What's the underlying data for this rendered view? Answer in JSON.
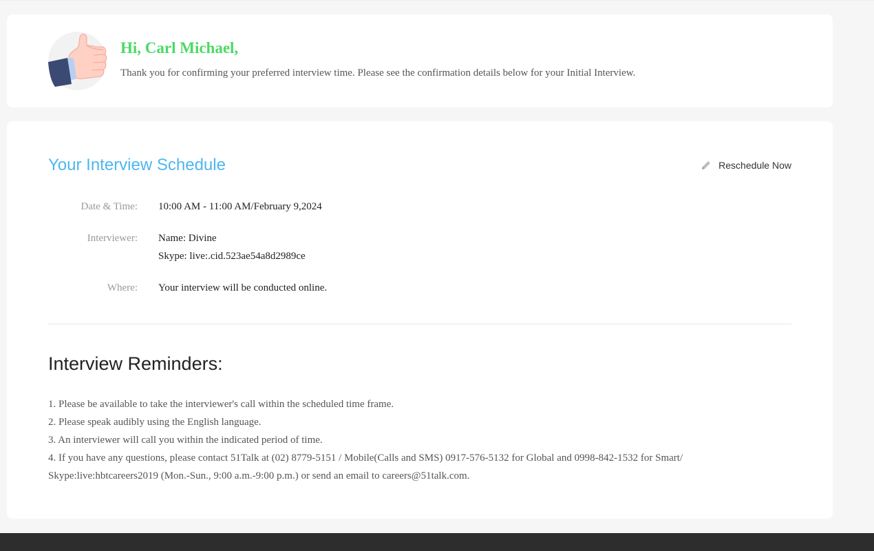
{
  "greeting": {
    "title": "Hi, Carl Michael,",
    "message": "Thank you for confirming your preferred interview time. Please see the confirmation details below for your Initial Interview."
  },
  "schedule": {
    "title": "Your Interview Schedule",
    "reschedule_label": "Reschedule Now",
    "rows": {
      "datetime": {
        "label": "Date & Time:",
        "value": "10:00 AM - 11:00 AM/February 9,2024"
      },
      "interviewer": {
        "label": "Interviewer:",
        "name": "Name: Divine",
        "skype": "Skype: live:.cid.523ae54a8d2989ce"
      },
      "where": {
        "label": "Where:",
        "value": "Your interview will be conducted online."
      }
    }
  },
  "reminders": {
    "title": "Interview Reminders:",
    "items": [
      "1. Please be available to take the interviewer's call within the scheduled time frame.",
      "2. Please speak audibly using the English language.",
      "3. An interviewer will call you within the indicated period of time.",
      "4. If you have any questions, please contact 51Talk at (02) 8779-5151 / Mobile(Calls and SMS) 0917-576-5132 for Global and 0998-842-1532 for Smart/ Skype:live:hbtcareers2019 (Mon.-Sun., 9:00 a.m.-9:00 p.m.) or send an email to careers@51talk.com."
    ]
  },
  "colors": {
    "greeting_green": "#4cd964",
    "schedule_blue": "#4db6f0",
    "footer": "#2d2d2d",
    "background": "#f6f6f6"
  },
  "icons": {
    "avatar": "thumbs-up-icon",
    "reschedule": "pencil-icon"
  }
}
